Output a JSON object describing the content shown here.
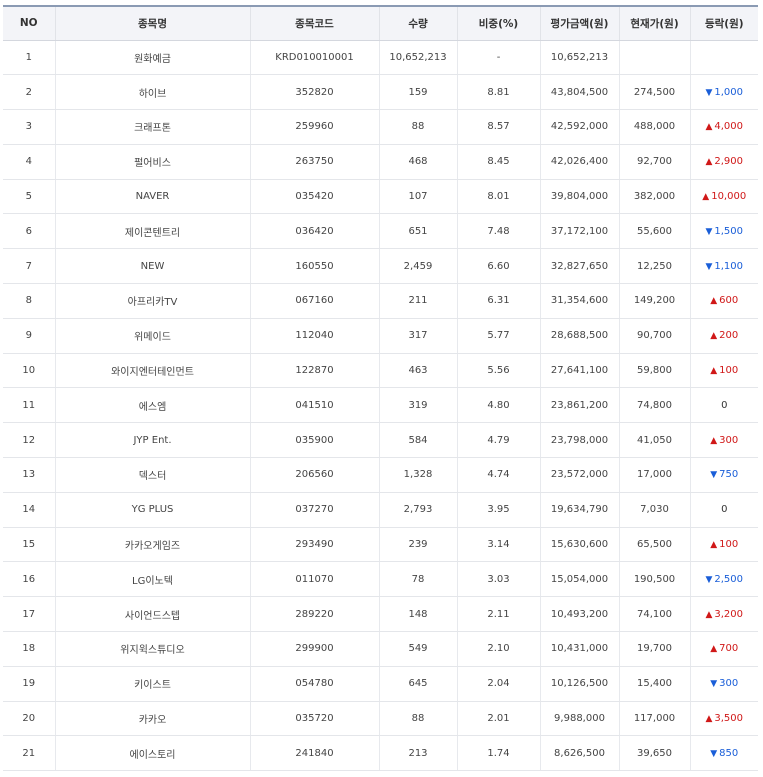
{
  "headers": {
    "no": "NO",
    "name": "종목명",
    "code": "종목코드",
    "qty": "수량",
    "weight": "비중(%)",
    "value": "평가금액(원)",
    "price": "현재가(원)",
    "change": "등락(원)"
  },
  "colors": {
    "up": "#d01818",
    "down": "#1a5ed8"
  },
  "rows": [
    {
      "no": "1",
      "name": "원화예금",
      "code": "KRD010010001",
      "qty": "10,652,213",
      "weight": "-",
      "value": "10,652,213",
      "price": "",
      "change": "",
      "dir": "none"
    },
    {
      "no": "2",
      "name": "하이브",
      "code": "352820",
      "qty": "159",
      "weight": "8.81",
      "value": "43,804,500",
      "price": "274,500",
      "change": "1,000",
      "dir": "down"
    },
    {
      "no": "3",
      "name": "크래프톤",
      "code": "259960",
      "qty": "88",
      "weight": "8.57",
      "value": "42,592,000",
      "price": "488,000",
      "change": "4,000",
      "dir": "up"
    },
    {
      "no": "4",
      "name": "펄어비스",
      "code": "263750",
      "qty": "468",
      "weight": "8.45",
      "value": "42,026,400",
      "price": "92,700",
      "change": "2,900",
      "dir": "up"
    },
    {
      "no": "5",
      "name": "NAVER",
      "code": "035420",
      "qty": "107",
      "weight": "8.01",
      "value": "39,804,000",
      "price": "382,000",
      "change": "10,000",
      "dir": "up"
    },
    {
      "no": "6",
      "name": "제이콘텐트리",
      "code": "036420",
      "qty": "651",
      "weight": "7.48",
      "value": "37,172,100",
      "price": "55,600",
      "change": "1,500",
      "dir": "down"
    },
    {
      "no": "7",
      "name": "NEW",
      "code": "160550",
      "qty": "2,459",
      "weight": "6.60",
      "value": "32,827,650",
      "price": "12,250",
      "change": "1,100",
      "dir": "down"
    },
    {
      "no": "8",
      "name": "아프리카TV",
      "code": "067160",
      "qty": "211",
      "weight": "6.31",
      "value": "31,354,600",
      "price": "149,200",
      "change": "600",
      "dir": "up"
    },
    {
      "no": "9",
      "name": "위메이드",
      "code": "112040",
      "qty": "317",
      "weight": "5.77",
      "value": "28,688,500",
      "price": "90,700",
      "change": "200",
      "dir": "up"
    },
    {
      "no": "10",
      "name": "와이지엔터테인먼트",
      "code": "122870",
      "qty": "463",
      "weight": "5.56",
      "value": "27,641,100",
      "price": "59,800",
      "change": "100",
      "dir": "up"
    },
    {
      "no": "11",
      "name": "에스엠",
      "code": "041510",
      "qty": "319",
      "weight": "4.80",
      "value": "23,861,200",
      "price": "74,800",
      "change": "0",
      "dir": "flat"
    },
    {
      "no": "12",
      "name": "JYP Ent.",
      "code": "035900",
      "qty": "584",
      "weight": "4.79",
      "value": "23,798,000",
      "price": "41,050",
      "change": "300",
      "dir": "up"
    },
    {
      "no": "13",
      "name": "덱스터",
      "code": "206560",
      "qty": "1,328",
      "weight": "4.74",
      "value": "23,572,000",
      "price": "17,000",
      "change": "750",
      "dir": "down"
    },
    {
      "no": "14",
      "name": "YG PLUS",
      "code": "037270",
      "qty": "2,793",
      "weight": "3.95",
      "value": "19,634,790",
      "price": "7,030",
      "change": "0",
      "dir": "flat"
    },
    {
      "no": "15",
      "name": "카카오게임즈",
      "code": "293490",
      "qty": "239",
      "weight": "3.14",
      "value": "15,630,600",
      "price": "65,500",
      "change": "100",
      "dir": "up"
    },
    {
      "no": "16",
      "name": "LG이노텍",
      "code": "011070",
      "qty": "78",
      "weight": "3.03",
      "value": "15,054,000",
      "price": "190,500",
      "change": "2,500",
      "dir": "down"
    },
    {
      "no": "17",
      "name": "사이언드스텝",
      "code": "289220",
      "qty": "148",
      "weight": "2.11",
      "value": "10,493,200",
      "price": "74,100",
      "change": "3,200",
      "dir": "up"
    },
    {
      "no": "18",
      "name": "위지윅스튜디오",
      "code": "299900",
      "qty": "549",
      "weight": "2.10",
      "value": "10,431,000",
      "price": "19,700",
      "change": "700",
      "dir": "up"
    },
    {
      "no": "19",
      "name": "키이스트",
      "code": "054780",
      "qty": "645",
      "weight": "2.04",
      "value": "10,126,500",
      "price": "15,400",
      "change": "300",
      "dir": "down"
    },
    {
      "no": "20",
      "name": "카카오",
      "code": "035720",
      "qty": "88",
      "weight": "2.01",
      "value": "9,988,000",
      "price": "117,000",
      "change": "3,500",
      "dir": "up"
    },
    {
      "no": "21",
      "name": "에이스토리",
      "code": "241840",
      "qty": "213",
      "weight": "1.74",
      "value": "8,626,500",
      "price": "39,650",
      "change": "850",
      "dir": "down"
    }
  ]
}
